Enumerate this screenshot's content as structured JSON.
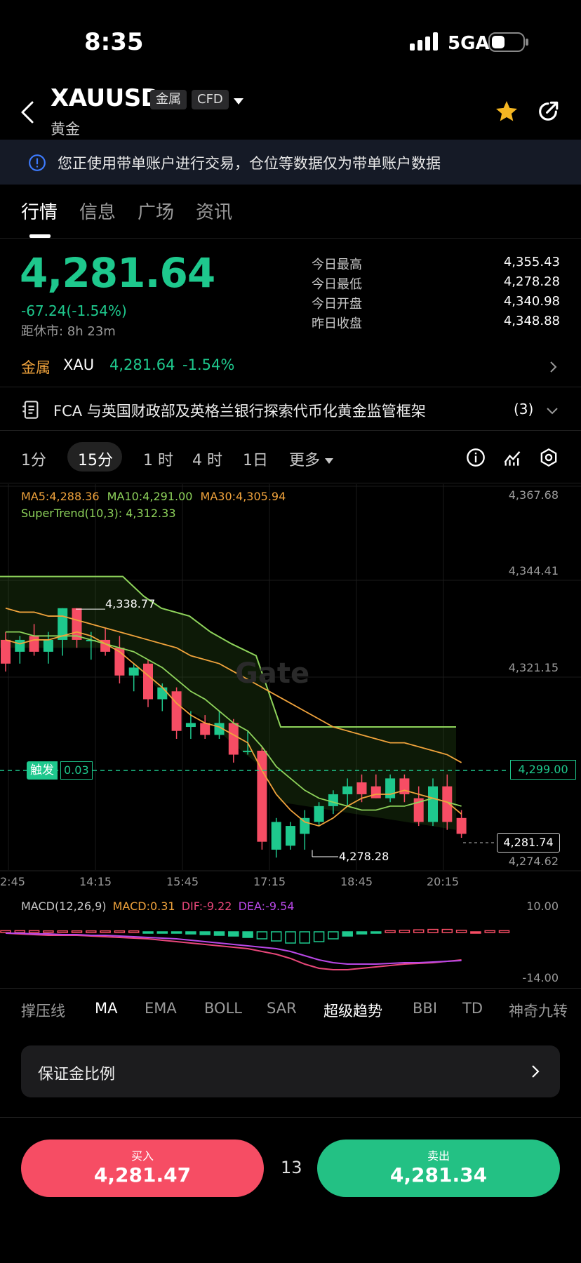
{
  "status_bar": {
    "time": "8:35",
    "network": "5GA"
  },
  "header": {
    "symbol": "XAUUSD",
    "tags": [
      "金属",
      "CFD"
    ],
    "name": "黄金"
  },
  "banner": {
    "text": "您正使用带单账户进行交易，仓位等数据仅为带单账户数据"
  },
  "tabs": [
    {
      "label": "行情",
      "active": true
    },
    {
      "label": "信息"
    },
    {
      "label": "广场"
    },
    {
      "label": "资讯"
    }
  ],
  "quote": {
    "price": "4,281.64",
    "change": "-67.24(-1.54%)",
    "close_countdown": "距休市: 8h 23m",
    "stats": [
      {
        "label": "今日最高",
        "value": "4,355.43"
      },
      {
        "label": "今日最低",
        "value": "4,278.28"
      },
      {
        "label": "今日开盘",
        "value": "4,340.98"
      },
      {
        "label": "昨日收盘",
        "value": "4,348.88"
      }
    ]
  },
  "category_row": {
    "category": "金属",
    "code": "XAU",
    "price": "4,281.64",
    "change": "-1.54%"
  },
  "news": {
    "text": "FCA 与英国财政部及英格兰银行探索代币化黄金监管框架",
    "count": "(3)"
  },
  "timeframes": [
    "1分",
    "15分",
    "1 时",
    "4 时",
    "1日",
    "更多"
  ],
  "active_timeframe": "15分",
  "chart_legend": {
    "ma5": "MA5:4,288.36",
    "ma10": "MA10:4,291.00",
    "ma30": "MA30:4,305.94",
    "supertrend": "SuperTrend(10,3): 4,312.33"
  },
  "chart_data": {
    "type": "candlestick",
    "y_axis_labels": [
      "4,367.68",
      "4,344.41",
      "4,321.15",
      "4,274.62"
    ],
    "x_axis_labels": [
      "2:45",
      "14:15",
      "15:45",
      "17:15",
      "18:45",
      "20:15"
    ],
    "annotations": {
      "high_marker": "4,338.77",
      "low_marker": "4,278.28",
      "trigger_label": "触发",
      "trigger_value": "0.03",
      "trigger_price": "4,299.00",
      "last_price": "4,281.74"
    },
    "candles": [
      {
        "o": 4331,
        "h": 4333,
        "l": 4323,
        "c": 4325
      },
      {
        "o": 4328,
        "h": 4332,
        "l": 4325,
        "c": 4331
      },
      {
        "o": 4332,
        "h": 4335,
        "l": 4327,
        "c": 4328
      },
      {
        "o": 4328,
        "h": 4333,
        "l": 4325,
        "c": 4331
      },
      {
        "o": 4331,
        "h": 4339,
        "l": 4327,
        "c": 4339
      },
      {
        "o": 4339,
        "h": 4339,
        "l": 4329,
        "c": 4331
      },
      {
        "o": 4331,
        "h": 4333,
        "l": 4326,
        "c": 4331
      },
      {
        "o": 4331,
        "h": 4334,
        "l": 4327,
        "c": 4328
      },
      {
        "o": 4329,
        "h": 4332,
        "l": 4320,
        "c": 4322
      },
      {
        "o": 4322,
        "h": 4325,
        "l": 4318,
        "c": 4324
      },
      {
        "o": 4325,
        "h": 4326,
        "l": 4314,
        "c": 4316
      },
      {
        "o": 4316,
        "h": 4320,
        "l": 4313,
        "c": 4319
      },
      {
        "o": 4318,
        "h": 4319,
        "l": 4306,
        "c": 4308
      },
      {
        "o": 4309,
        "h": 4313,
        "l": 4306,
        "c": 4310
      },
      {
        "o": 4310,
        "h": 4312,
        "l": 4306,
        "c": 4307
      },
      {
        "o": 4307,
        "h": 4313,
        "l": 4306,
        "c": 4310
      },
      {
        "o": 4310,
        "h": 4311,
        "l": 4300,
        "c": 4302
      },
      {
        "o": 4303,
        "h": 4308,
        "l": 4302,
        "c": 4303
      },
      {
        "o": 4303,
        "h": 4304,
        "l": 4278,
        "c": 4280
      },
      {
        "o": 4278,
        "h": 4286,
        "l": 4276,
        "c": 4285
      },
      {
        "o": 4279,
        "h": 4285,
        "l": 4278,
        "c": 4284
      },
      {
        "o": 4282,
        "h": 4288,
        "l": 4278,
        "c": 4286
      },
      {
        "o": 4285,
        "h": 4290,
        "l": 4284,
        "c": 4289
      },
      {
        "o": 4289,
        "h": 4293,
        "l": 4287,
        "c": 4292
      },
      {
        "o": 4292,
        "h": 4296,
        "l": 4289,
        "c": 4294
      },
      {
        "o": 4295,
        "h": 4297,
        "l": 4290,
        "c": 4292
      },
      {
        "o": 4294,
        "h": 4297,
        "l": 4291,
        "c": 4291
      },
      {
        "o": 4291,
        "h": 4297,
        "l": 4290,
        "c": 4296
      },
      {
        "o": 4296,
        "h": 4297,
        "l": 4290,
        "c": 4292
      },
      {
        "o": 4291,
        "h": 4294,
        "l": 4284,
        "c": 4285
      },
      {
        "o": 4285,
        "h": 4296,
        "l": 4284,
        "c": 4294
      },
      {
        "o": 4294,
        "h": 4297,
        "l": 4283,
        "c": 4285
      },
      {
        "o": 4286,
        "h": 4288,
        "l": 4281,
        "c": 4282
      }
    ],
    "macd_axis_labels": [
      "10.00",
      "-14.00"
    ]
  },
  "macd_legend": {
    "title": "MACD(12,26,9)",
    "macd": "MACD:0.31",
    "dif": "DIF:-9.22",
    "dea": "DEA:-9.54"
  },
  "indicators": [
    "撑压线",
    "MA",
    "EMA",
    "BOLL",
    "SAR",
    "超级趋势",
    "BBI",
    "TD",
    "神奇九转"
  ],
  "margin_ratio": {
    "label": "保证金比例"
  },
  "trade": {
    "buy_label": "买入",
    "buy_price": "4,281.47",
    "spread": "13",
    "sell_label": "卖出",
    "sell_price": "4,281.34"
  },
  "colors": {
    "up": "#1ec88d",
    "down": "#f64d64",
    "ma5": "#f0a33c",
    "ma10": "#8ed35b",
    "ma30": "#f0a33c",
    "dif": "#e8477a",
    "dea": "#b948e8"
  }
}
